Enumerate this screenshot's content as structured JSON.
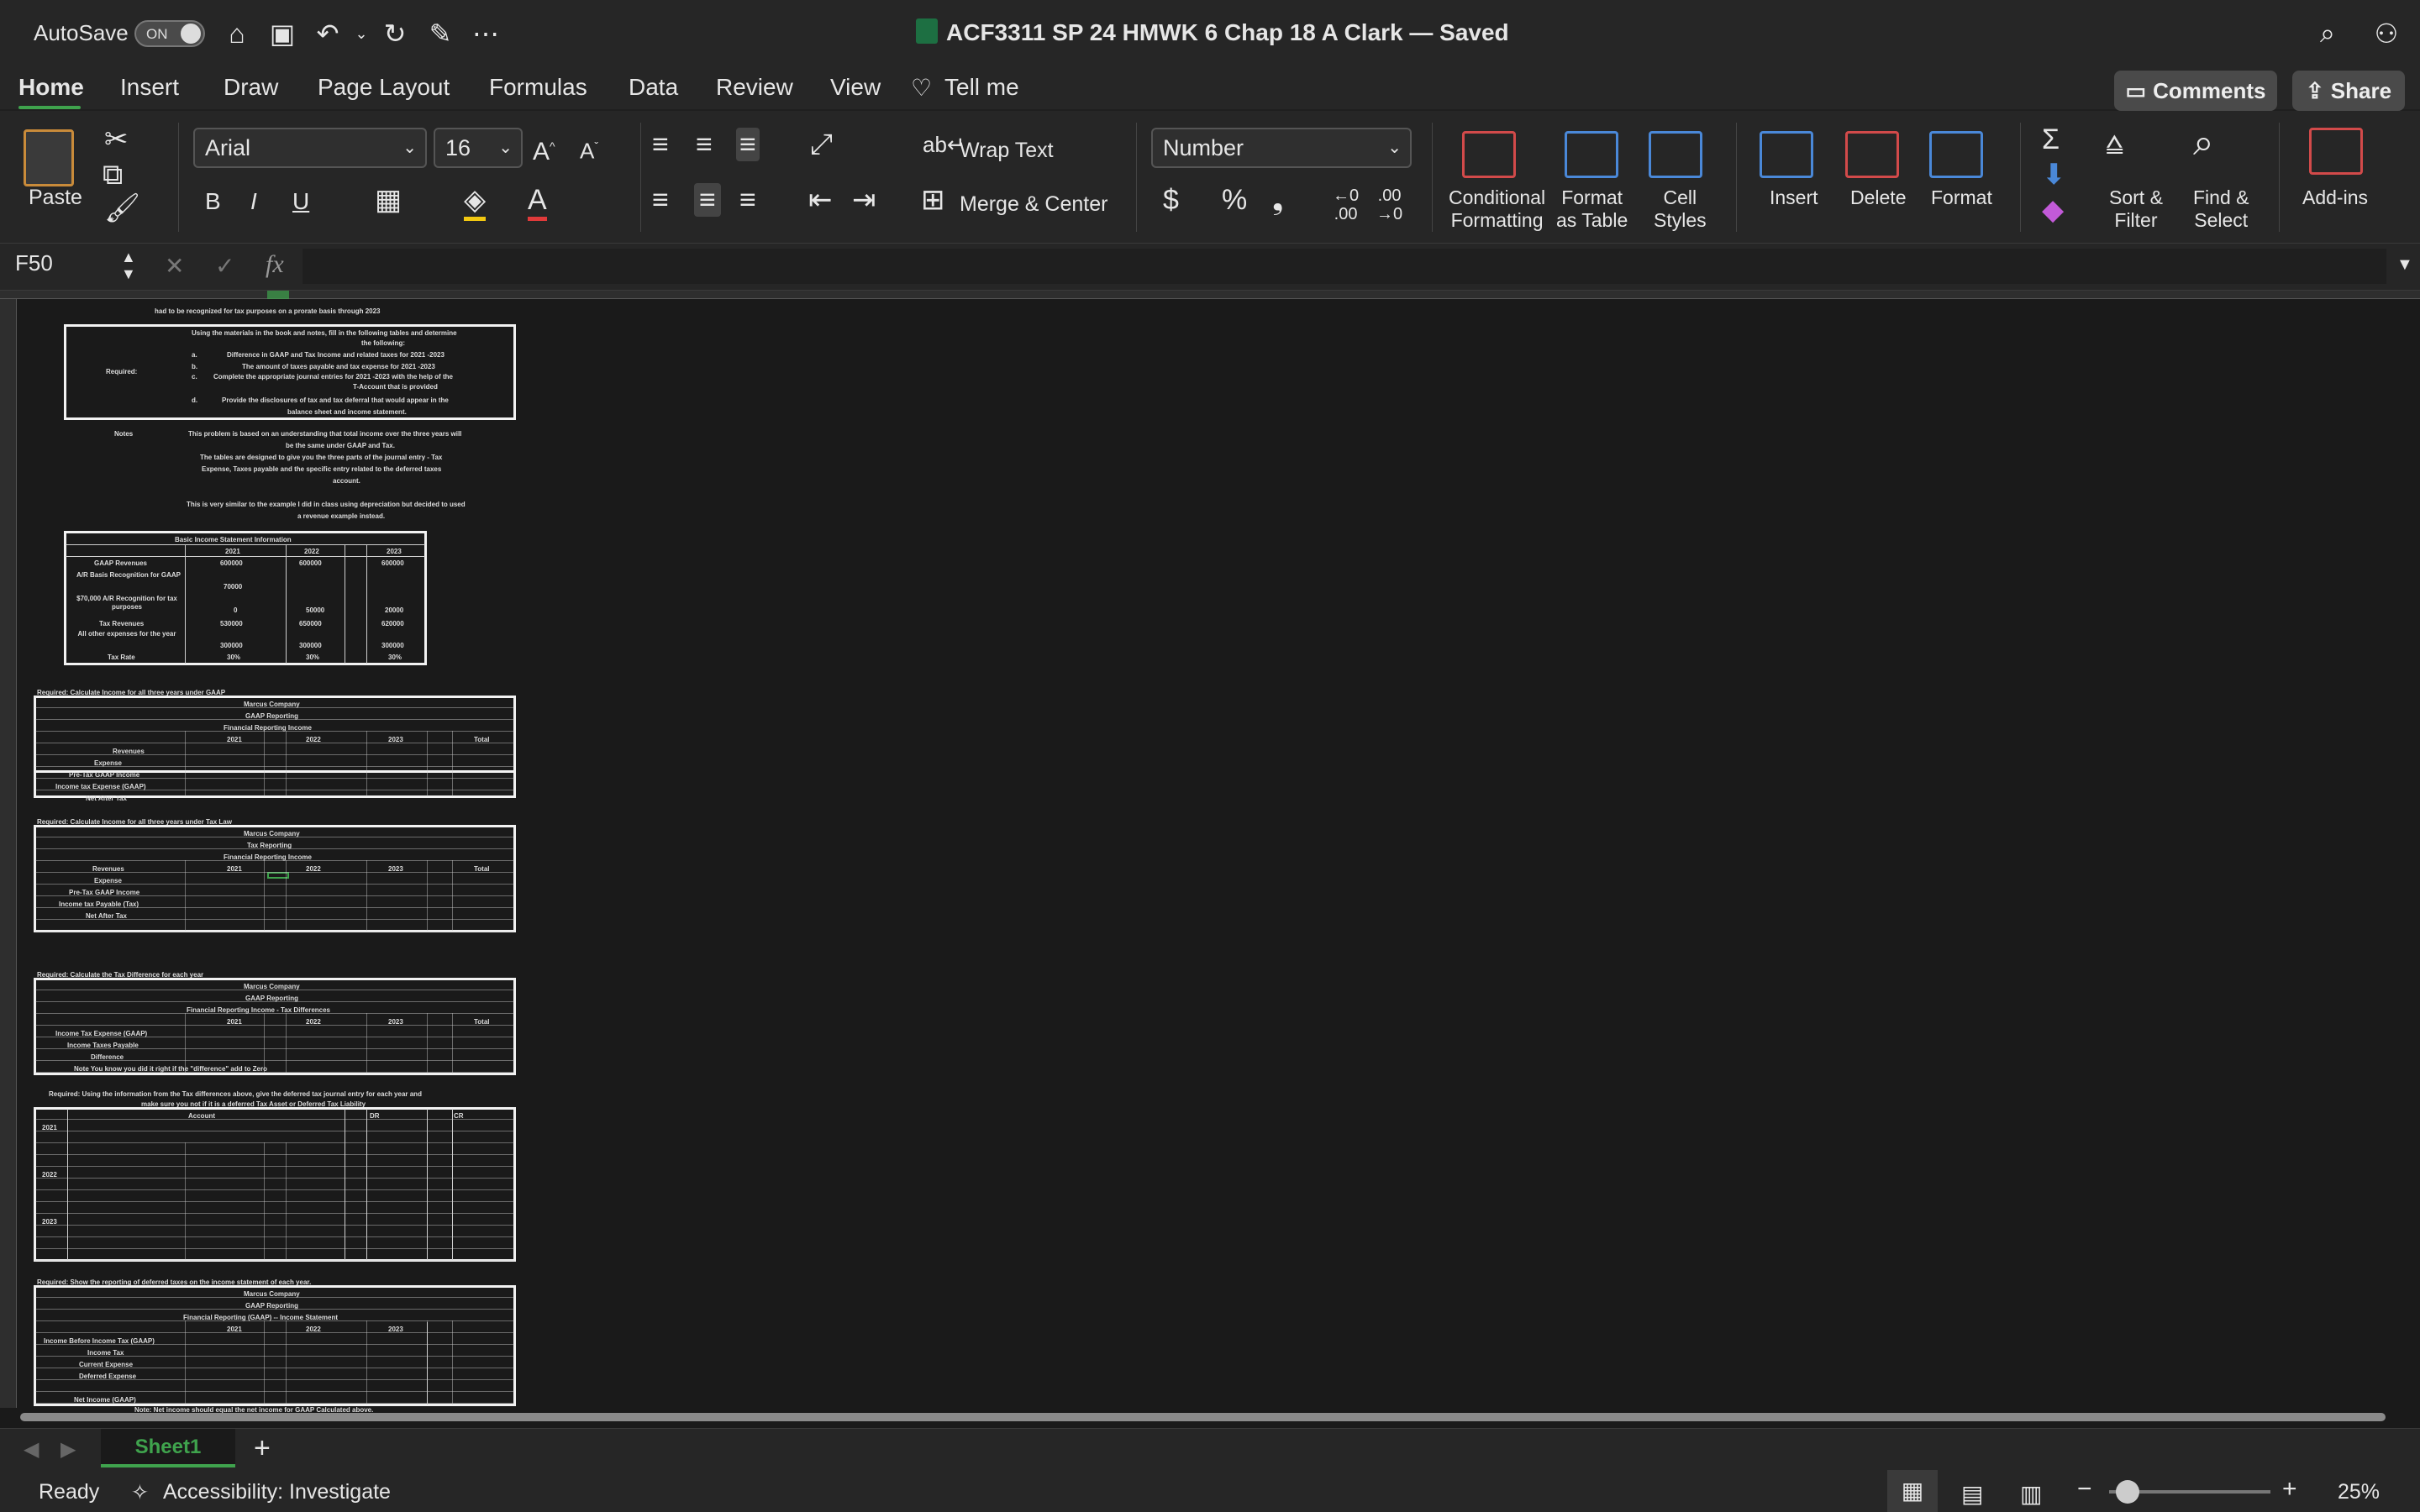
{
  "titlebar": {
    "autosave": "AutoSave",
    "toggle": "ON",
    "doc_title": "ACF3311 SP 24 HMWK 6 Chap 18 A Clark — Saved",
    "dropdown": "⌄"
  },
  "tabs": [
    "Home",
    "Insert",
    "Draw",
    "Page Layout",
    "Formulas",
    "Data",
    "Review",
    "View"
  ],
  "tell_me": "Tell me",
  "comments": "Comments",
  "share": "Share",
  "ribbon": {
    "paste": "Paste",
    "font": "Arial",
    "size": "16",
    "wrap_text": "Wrap Text",
    "merge_center": "Merge & Center",
    "number_format": "Number",
    "bold": "B",
    "italic": "I",
    "underline": "U",
    "dollar": "$",
    "percent": "%",
    "comma": "❟",
    "inc_dec": ".00",
    "dec_dec": ".00",
    "cond_fmt": [
      "Conditional",
      "Formatting"
    ],
    "fmt_table": [
      "Format",
      "as Table"
    ],
    "cell_styles": [
      "Cell",
      "Styles"
    ],
    "insert": "Insert",
    "delete": "Delete",
    "format": "Format",
    "sort_filter": [
      "Sort &",
      "Filter"
    ],
    "find_select": [
      "Find &",
      "Select"
    ],
    "addins": "Add-ins"
  },
  "formula_bar": {
    "name_box": "F50",
    "fx": "fx"
  },
  "sheet": {
    "intro": "had to be recognized for tax purposes on a prorate basis through 2023",
    "required_label": "Required:",
    "req_lines": [
      "Using the materials in the book and notes, fill in the following tables and determine",
      "the following:",
      "Difference in GAAP and Tax Income and related taxes for 2021 -2023",
      "The amount of taxes payable and tax expense for 2021 -2023",
      "Complete the appropriate journal entries for 2021 -2023 with the help of the",
      "T-Account that is provided",
      "Provide the disclosures of tax and tax deferral that would appear in the",
      "balance sheet and income statement."
    ],
    "req_letters": [
      "a.",
      "b.",
      "c.",
      "d."
    ],
    "notes_label": "Notes",
    "notes_lines": [
      "This problem is based on an understanding that total income over the three years will",
      "be the same under GAAP and Tax.",
      "The tables are designed  to give you the three parts of the journal entry - Tax",
      "Expense, Taxes payable and the specific entry related to the deferred taxes",
      "account.",
      "This is very similar to the example I did in class using depreciation but decided to used",
      "a revenue example instead."
    ],
    "basic": {
      "title": "Basic Income Statement Information",
      "years": [
        "2021",
        "2022",
        "2023"
      ],
      "rows": [
        [
          "GAAP Revenues",
          "600000",
          "600000",
          "600000"
        ],
        [
          "A/R Basis Recognition for GAAP",
          "70000",
          "",
          ""
        ],
        [
          "$70,000 A/R Recognition for tax purposes",
          "0",
          "50000",
          "20000"
        ],
        [
          "Tax Revenues",
          "530000",
          "650000",
          "620000"
        ],
        [
          "All other expenses for the year",
          "300000",
          "300000",
          "300000"
        ],
        [
          "Tax Rate",
          "30%",
          "30%",
          "30%"
        ]
      ]
    },
    "t1": {
      "req": "Required: Calculate Income for all three years under GAAP",
      "co": "Marcus Company",
      "sub": "GAAP Reporting",
      "name": "Financial Reporting Income",
      "cols": [
        "2021",
        "2022",
        "2023",
        "Total"
      ],
      "rows": [
        "Revenues",
        "Expense",
        "Pre-Tax GAAP Income",
        "Income tax Expense (GAAP)",
        "Net After Tax"
      ]
    },
    "t2": {
      "req": "Required: Calculate Income for all three years under Tax Law",
      "co": "Marcus Company",
      "sub": "Tax Reporting",
      "name": "Financial Reporting Income",
      "cols": [
        "2021",
        "2022",
        "2023",
        "Total"
      ],
      "rows": [
        "Revenues",
        "Expense",
        "Pre-Tax GAAP Income",
        "Income tax Payable (Tax)",
        "Net After Tax"
      ]
    },
    "t3": {
      "req": "Required: Calculate the Tax Difference for each year",
      "co": "Marcus Company",
      "sub": "GAAP Reporting",
      "name": "Financial Reporting Income - Tax Differences",
      "cols": [
        "2021",
        "2022",
        "2023",
        "Total"
      ],
      "rows": [
        "Income Tax Expense (GAAP)",
        "Income Taxes Payable",
        "Difference",
        "Note You know you did it right if the \"difference\" add to Zero"
      ]
    },
    "t4": {
      "req": [
        "Required: Using the information from the Tax differences above, give the deferred tax journal entry for each year and",
        "make sure you not if it is a deferred Tax Asset or Deferred Tax Liability"
      ],
      "cols": [
        "Account",
        "DR",
        "CR"
      ],
      "years": [
        "2021",
        "2022",
        "2023"
      ]
    },
    "t5": {
      "req": "Required: Show the reporting of deferred taxes on the income statement of each year.",
      "co": "Marcus Company",
      "sub": "GAAP Reporting",
      "name": "Financial Reporting (GAAP) -- Income Statement",
      "cols": [
        "2021",
        "2022",
        "2023"
      ],
      "rows": [
        "Income Before Income Tax (GAAP)",
        "Income Tax",
        "Current Expense",
        "Deferred Expense",
        "",
        "Net Income (GAAP)"
      ],
      "note": "Note: Net income should equal the net income for GAAP Calculated above."
    }
  },
  "sheet_tab": "Sheet1",
  "status": {
    "ready": "Ready",
    "accessibility": "Accessibility: Investigate",
    "zoom": "25%"
  }
}
